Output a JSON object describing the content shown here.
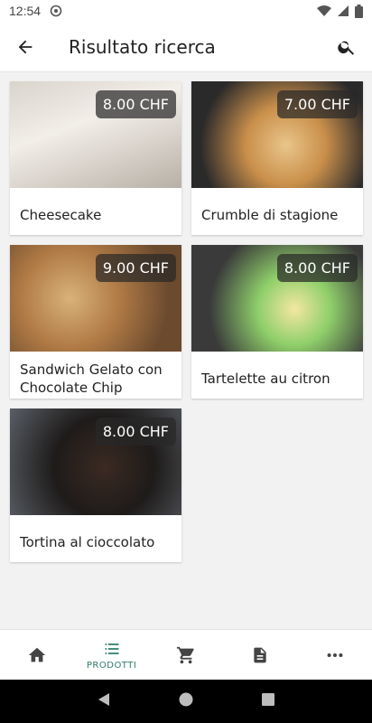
{
  "status_bar": {
    "time": "12:54"
  },
  "app_bar": {
    "title": "Risultato ricerca",
    "back_icon": "arrow-back-icon",
    "search_icon": "search-icon"
  },
  "products": [
    {
      "name": "Cheesecake",
      "price": "8.00 CHF"
    },
    {
      "name": "Crumble di stagione",
      "price": "7.00 CHF"
    },
    {
      "name": "Sandwich Gelato con Chocolate Chip",
      "price": "9.00 CHF"
    },
    {
      "name": "Tartelette au citron",
      "price": "8.00 CHF"
    },
    {
      "name": "Tortina al cioccolato",
      "price": "8.00 CHF"
    }
  ],
  "bottom_nav": {
    "items": [
      {
        "icon": "home-icon"
      },
      {
        "icon": "list-icon",
        "label": "PRODOTTI",
        "active": true
      },
      {
        "icon": "cart-icon"
      },
      {
        "icon": "document-icon"
      },
      {
        "icon": "more-icon"
      }
    ]
  },
  "colors": {
    "accent": "#2e7d6b",
    "background": "#f2f2f2"
  }
}
